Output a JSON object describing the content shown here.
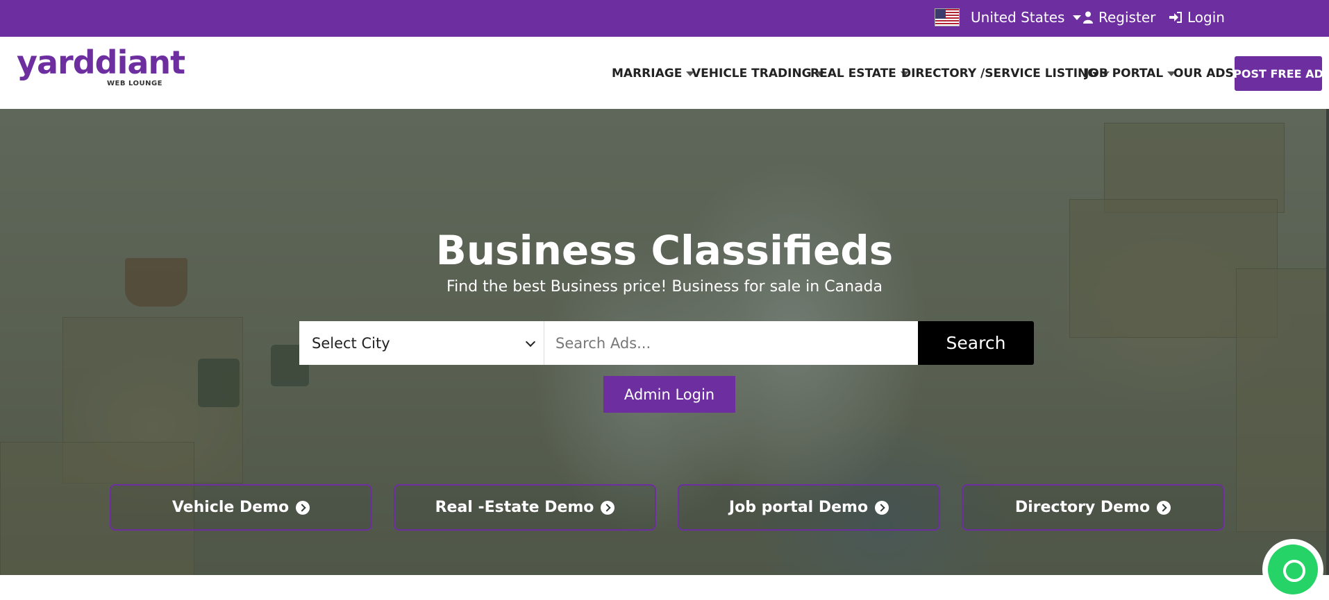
{
  "topbar": {
    "country": "United States",
    "register": "Register",
    "login": "Login"
  },
  "logo": {
    "word": "yarddiant",
    "sub": "WEB LOUNGE"
  },
  "nav": {
    "items": [
      {
        "label": "MARRIAGE",
        "dropdown": true
      },
      {
        "label": "VEHICLE TRADING",
        "dropdown": true
      },
      {
        "label": "REAL ESTATE",
        "dropdown": true
      },
      {
        "label": "DIRECTORY /SERVICE LISTING",
        "dropdown": true
      },
      {
        "label": "JOB PORTAL",
        "dropdown": true
      },
      {
        "label": "OUR ADS",
        "dropdown": false
      }
    ],
    "post_ad": "POST FREE AD"
  },
  "hero": {
    "title": "Business Classifieds",
    "subtitle": "Find the best Business price! Business for sale in Canada",
    "city_select": "Select City",
    "search_placeholder": "Search Ads...",
    "search_button": "Search",
    "admin_login": "Admin Login",
    "demos": [
      {
        "label": "Vehicle Demo"
      },
      {
        "label": "Real -Estate Demo"
      },
      {
        "label": "Job portal Demo"
      },
      {
        "label": "Directory Demo"
      }
    ]
  },
  "colors": {
    "brand": "#6d2fa0",
    "search_button": "#000000",
    "whatsapp": "#25d366"
  },
  "icons": {
    "country": "us-flag-icon",
    "register": "user-icon",
    "login": "sign-in-icon",
    "demo": "circle-arrow-right-icon",
    "chat": "whatsapp-icon"
  }
}
